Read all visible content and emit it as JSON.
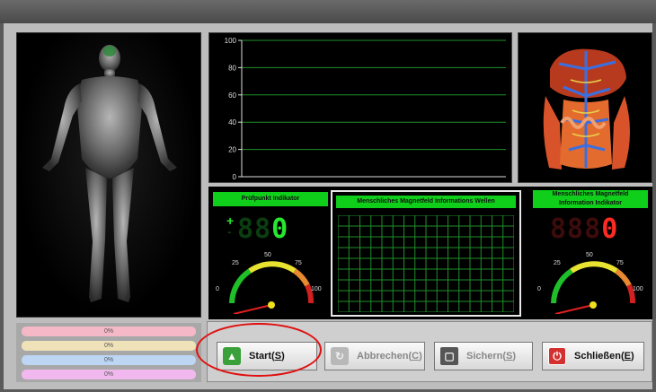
{
  "chart": {
    "y_ticks": [
      "100",
      "80",
      "60",
      "40",
      "20",
      "0"
    ]
  },
  "chart_data": {
    "type": "line",
    "ylim": [
      0,
      100
    ],
    "y_ticks": [
      0,
      20,
      40,
      60,
      80,
      100
    ],
    "series": [],
    "grid": true
  },
  "pruefpunkt": {
    "title": "Prüfpunkt Indikator",
    "plus": "+",
    "minus": "-",
    "digits_dim": "88",
    "digit_lit": "0",
    "gauge": {
      "min": "0",
      "q1": "25",
      "mid": "50",
      "q3": "75",
      "max": "100",
      "value": 0
    }
  },
  "wave": {
    "title": "Menschliches Magnetfeld Informations Wellen"
  },
  "magnet": {
    "title_line1": "Menschliches Magnetfeld",
    "title_line2": "Information Indikator",
    "digits_dim": "888",
    "digit_lit": "0",
    "gauge": {
      "min": "0",
      "q1": "25",
      "mid": "50",
      "q3": "75",
      "max": "100",
      "value": 0
    }
  },
  "progress": [
    {
      "label": "0%",
      "value": 0,
      "color": "#f4b8c6"
    },
    {
      "label": "0%",
      "value": 0,
      "color": "#efe2b8"
    },
    {
      "label": "0%",
      "value": 0,
      "color": "#bcd6f4"
    },
    {
      "label": "0%",
      "value": 0,
      "color": "#f0b8ee"
    }
  ],
  "buttons": {
    "start": {
      "text": "Start(",
      "key": "S",
      "end": ")"
    },
    "abbrechen": {
      "text": "Abbrechen(",
      "key": "C",
      "end": ")"
    },
    "sichern": {
      "text": "Sichern(",
      "key": "S",
      "end": ")"
    },
    "schliessen": {
      "text": "Schließen(",
      "key": "E",
      "end": ")"
    }
  },
  "colors": {
    "indicator_green": "#26e82f",
    "indicator_red": "#ff2a22",
    "header_green": "#0fcf1a",
    "highlight_ellipse": "#e01010"
  }
}
